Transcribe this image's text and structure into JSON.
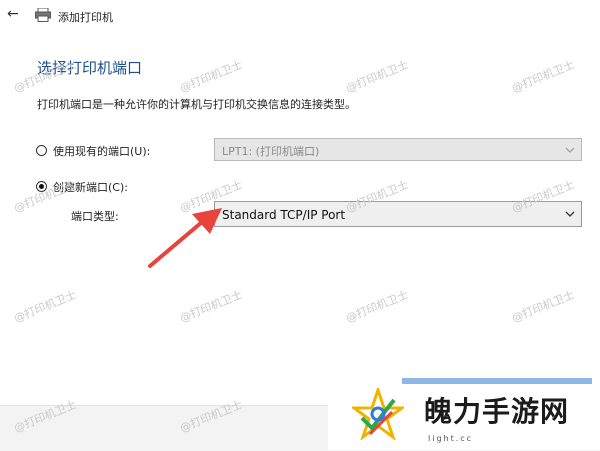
{
  "window": {
    "title": "添加打印机"
  },
  "heading": "选择打印机端口",
  "description": "打印机端口是一种允许你的计算机与打印机交换信息的连接类型。",
  "options": {
    "existing_port": {
      "label": "使用现有的端口(U):",
      "selected": false,
      "value": "LPT1: (打印机端口)"
    },
    "new_port": {
      "label": "创建新端口(C):",
      "selected": true
    },
    "port_type": {
      "label": "端口类型:",
      "value": "Standard TCP/IP Port"
    }
  },
  "watermark": "@打印机卫士",
  "branding": {
    "name": "魄力手游网",
    "url": "light.cc"
  },
  "colors": {
    "heading": "#1e4e8c",
    "arrow": "#e8443a",
    "disabled_bg": "#e6e6e6"
  }
}
